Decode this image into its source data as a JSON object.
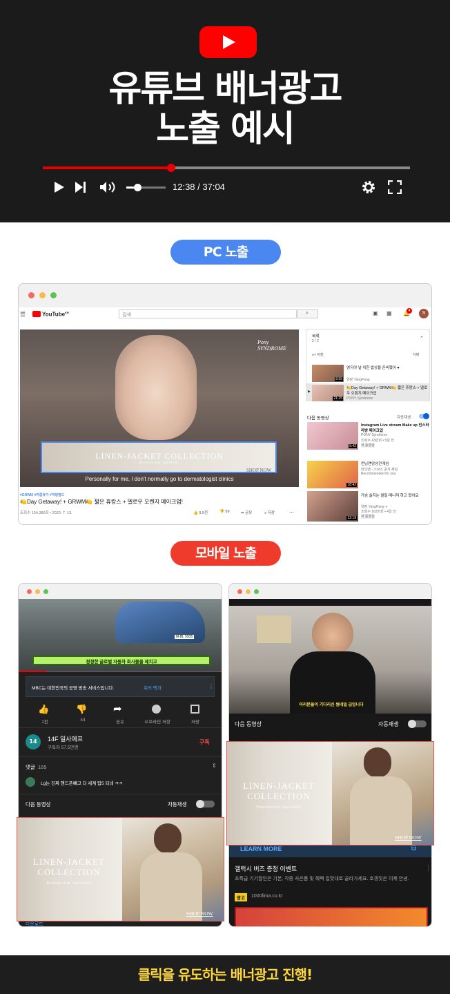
{
  "hero": {
    "title_line1": "유튜브 배너광고",
    "title_line2": "노출 예시",
    "time": "12:38 / 37:04",
    "progress_fraction": 0.35,
    "volume_fraction": 0.3,
    "accent_color": "#ff0000"
  },
  "sections": {
    "pc_label": "PC 노출",
    "mobile_label": "모바일 노출",
    "pc_color": "#4a87f0",
    "mobile_color": "#ef3b2c"
  },
  "pc": {
    "logo_text": "YouTube",
    "logo_sup": "KR",
    "search_placeholder": "검색",
    "avatar_letter": "S",
    "notif_count": "4",
    "brand_watermark": "Pony SYNDROME",
    "banner_title": "LINEN-JACKET COLLECTION",
    "banner_sub": "Dressroom laurenhi",
    "banner_cta": "SHOP NOW",
    "subtitle": "Personally for me, I don't normally go to dermatologist clinics",
    "hashtags": "#GRWM #여름휴가 #여행필드",
    "video_title": "🍋Day Getaway! + GRWM🍋 짧은 휴캉스 + 델로우 오렌지 메이크업!",
    "video_meta": "조회수 154,380회 • 2020. 7. 13.",
    "likes": "9.5천",
    "dislikes": "99",
    "share": "공유",
    "save": "저장",
    "playlist": {
      "title": "목록",
      "count": "2 / 2",
      "save": "저장",
      "delete": "삭제",
      "items": [
        {
          "title": "영지야 널 위한 밥상을 준비했어 ♥",
          "channel": "양팡 YangPang",
          "time": "8:55"
        },
        {
          "title": "🍋Day Getaway! + GRWM🍋 짧은 휴캉스 + 델로우 오렌지 메이크업",
          "channel": "PONY Syndrome",
          "time": "21:25"
        }
      ]
    },
    "next_label": "다음 동영상",
    "autoplay": "자동재생",
    "up_next": [
      {
        "title": "Instagram Live stream Make up 인스타 라방 메이크업",
        "channel": "PONY Syndrome",
        "meta": "조회수 43만회 • 5일 전",
        "badge": "새 동영상",
        "time": "5:42"
      },
      {
        "title": "런닝맨앙상전게임",
        "channel": "런닝맨 - 스브스 공식 채널",
        "meta": "Recommended for you",
        "badge": "",
        "time": "18:42"
      },
      {
        "title": "가슴 슬지는 월밀 매니저 하고 왔어요",
        "channel": "양팡 YangPang ✔",
        "meta": "조회수 162만회 • 4일 전",
        "badge": "새 동영상",
        "time": "12:19"
      }
    ]
  },
  "mobile_left": {
    "caption": "정정한 글로벌 자동차 회사들을 제치고",
    "plate": "M-BL 5935",
    "info_text": "MBC는 대한민국의 공영 방송 서비스입니다.",
    "info_link": "위키 백과",
    "actions": [
      {
        "label": "1천",
        "icon": "thumb-up-icon"
      },
      {
        "label": "44",
        "icon": "thumb-down-icon"
      },
      {
        "label": "공유",
        "icon": "share-icon"
      },
      {
        "label": "오프라인 저장",
        "icon": "download-icon"
      },
      {
        "label": "저장",
        "icon": "add-to-playlist-icon"
      }
    ],
    "channel_name": "14F 일사에프",
    "subscribers": "구독자 57.5만명",
    "subscribe": "구독",
    "comments_label": "댓글",
    "comments_count": "165",
    "comment_text": "Lg는 진짜 핸드폰빼고 다 세계 탑5 되네 ㅋㅋ",
    "next_label": "다음 동영상",
    "autoplay": "자동재생",
    "banner_title_1": "LINEN-JACKET",
    "banner_title_2": "COLLECTION",
    "banner_sub": "Dressroom laurenhi",
    "banner_cta": "SHOP NOW",
    "bottom_text": "다운로드"
  },
  "mobile_right": {
    "caption": "어리분들이 기다리신 썸네일 급입니다",
    "next_label": "다음 동영상",
    "autoplay": "자동재생",
    "banner_title_1": "LINEN-JACKET",
    "banner_title_2": "COLLECTION",
    "banner_sub": "Dressroom laurenhi",
    "banner_cta": "SHOP NOW",
    "learn_more": "LEARN MORE",
    "ad_title": "갤럭시 버즈 증정 이벤트",
    "ad_desc": "초특급 기기할인은 기본, 각종 사은품 및 혜택 입맛대로 골라가세요. 호갱짓은 이제 안녕.",
    "ad_badge": "광고",
    "ad_url": "1000lima.co.kr"
  },
  "footer": {
    "text": "클릭을 유도하는 배너광고 진행!"
  }
}
